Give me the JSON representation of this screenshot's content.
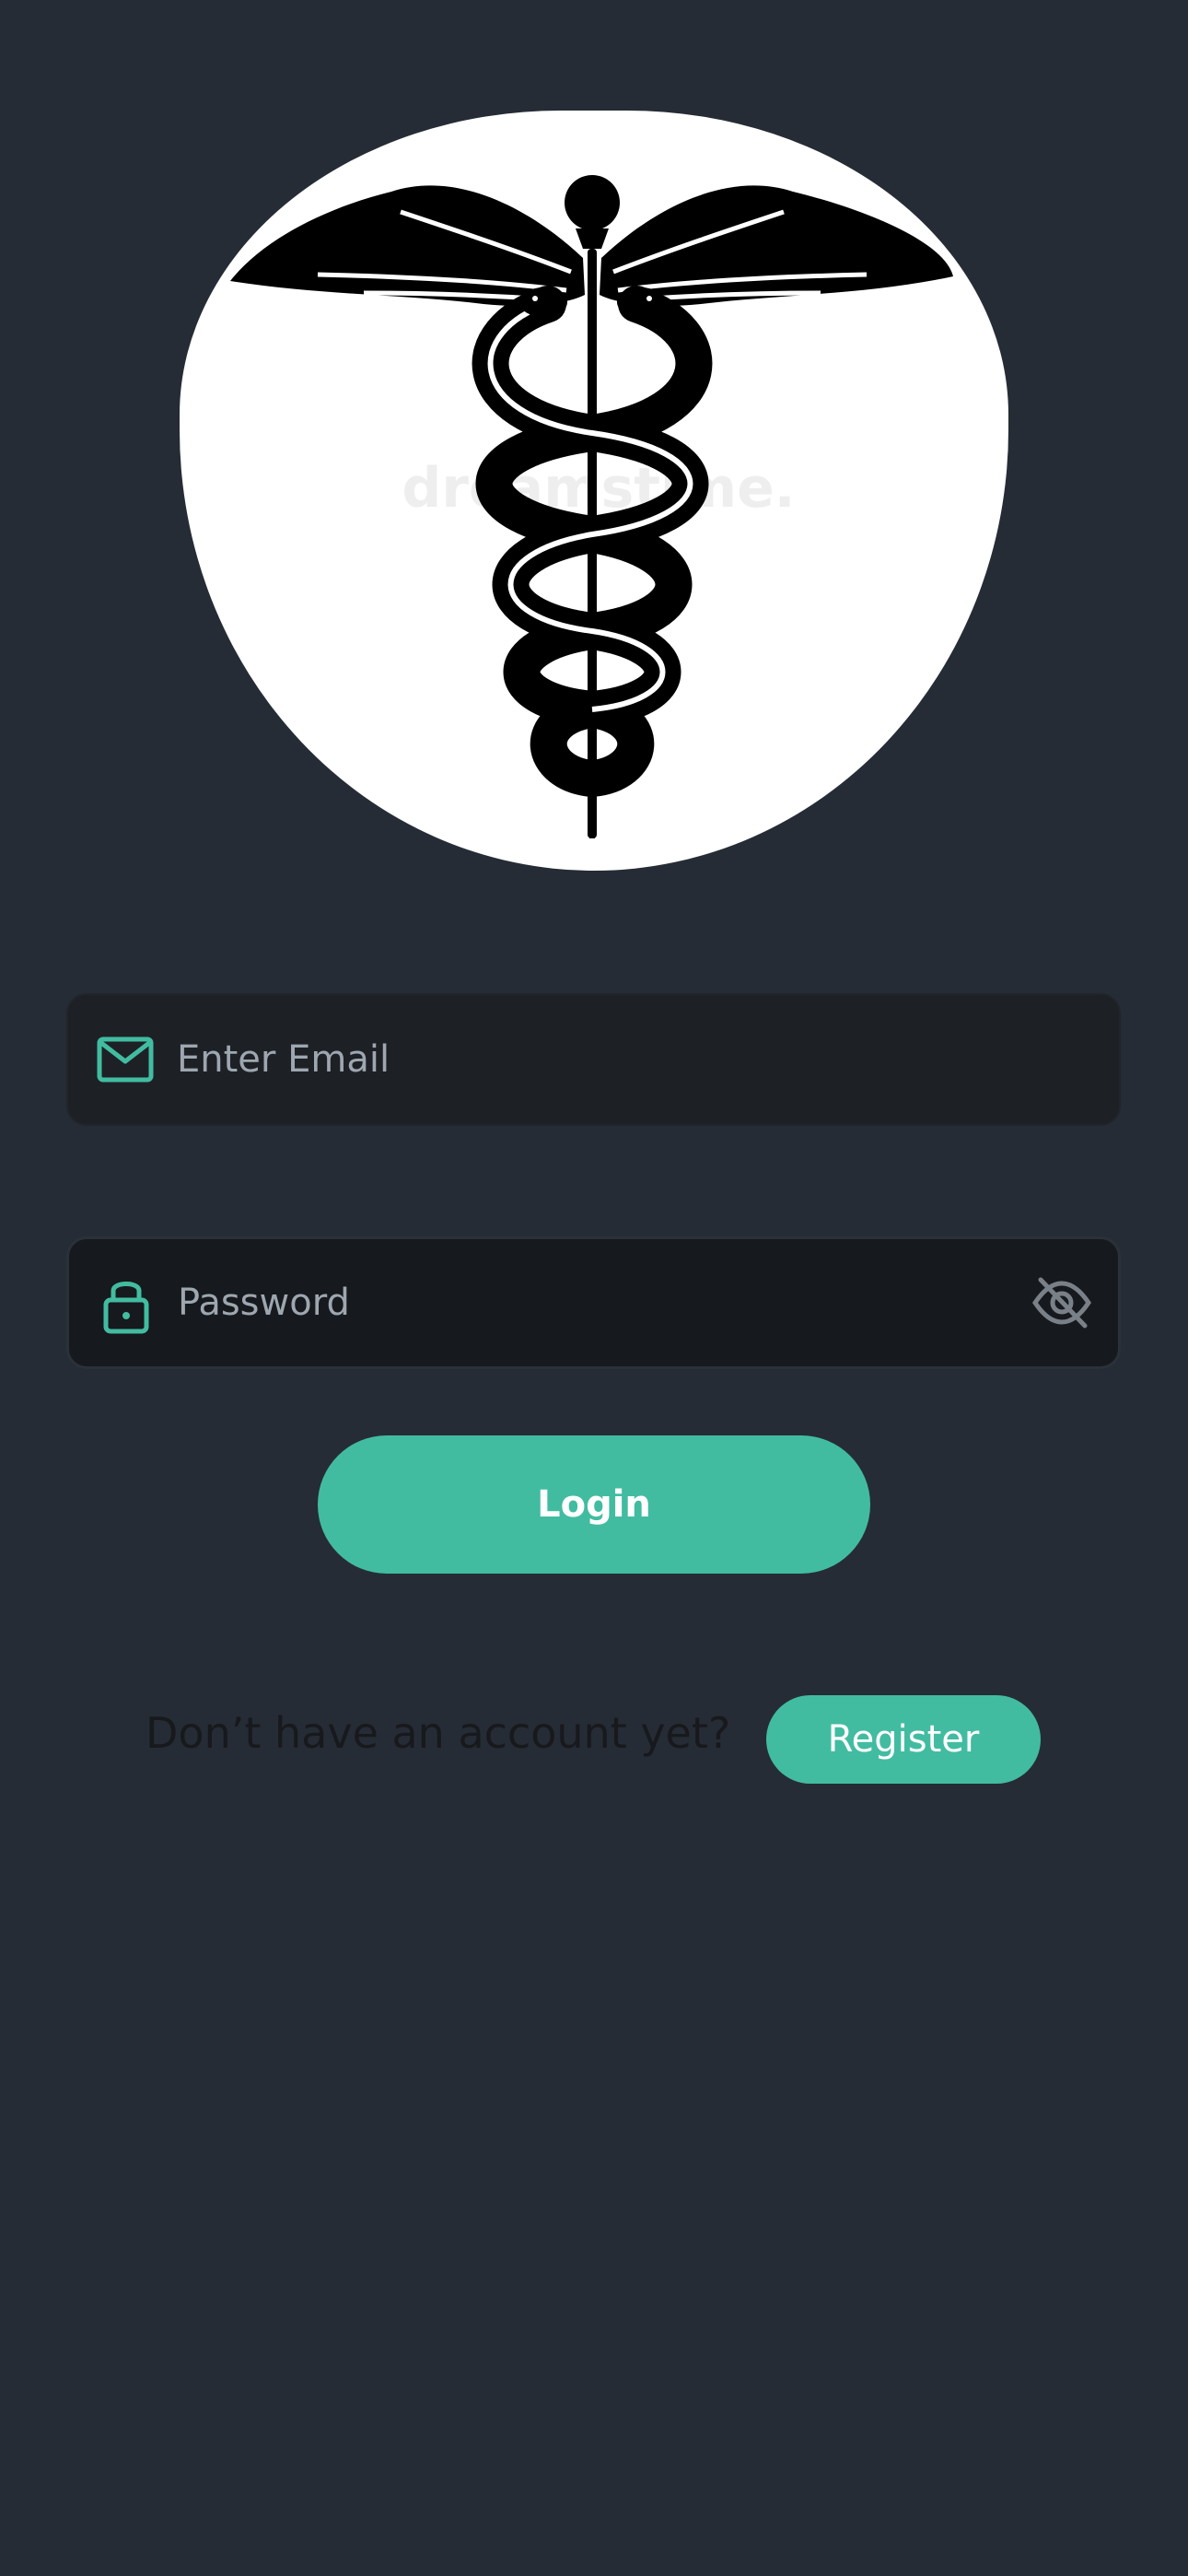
{
  "logo": {
    "icon": "caduceus-icon",
    "watermark": "dreamstime."
  },
  "email_field": {
    "placeholder": "Enter Email",
    "value": "",
    "icon": "mail-icon"
  },
  "password_field": {
    "placeholder": "Password",
    "value": "",
    "icon": "lock-icon",
    "toggle_icon": "eye-off-icon"
  },
  "login_button": {
    "label": "Login"
  },
  "register": {
    "prompt": "Don’t have an account yet?",
    "button_label": "Register"
  },
  "colors": {
    "background": "#262c35",
    "accent": "#42bca1",
    "field_background": "#1d2126"
  }
}
